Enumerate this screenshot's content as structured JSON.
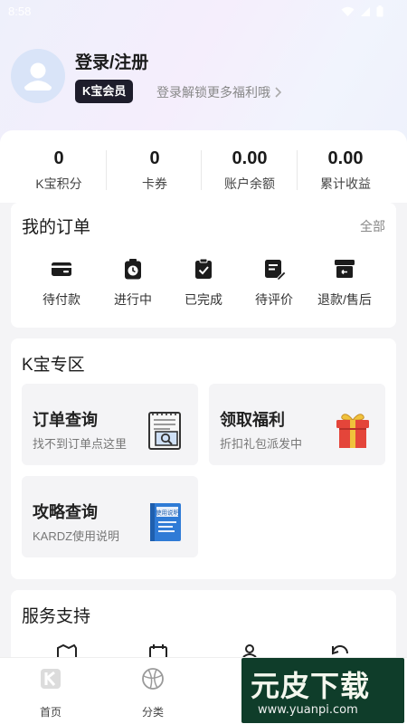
{
  "status_bar": {
    "time": "8:58"
  },
  "profile": {
    "login_title": "登录/注册",
    "vip_badge": "K宝会员",
    "vip_tip": "登录解锁更多福利哦"
  },
  "stats": [
    {
      "value": "0",
      "label": "K宝积分"
    },
    {
      "value": "0",
      "label": "卡券"
    },
    {
      "value": "0.00",
      "label": "账户余额"
    },
    {
      "value": "0.00",
      "label": "累计收益"
    }
  ],
  "orders": {
    "title": "我的订单",
    "all_label": "全部",
    "items": [
      {
        "label": "待付款",
        "icon": "wallet-icon"
      },
      {
        "label": "进行中",
        "icon": "stopwatch-icon"
      },
      {
        "label": "已完成",
        "icon": "clipboard-check-icon"
      },
      {
        "label": "待评价",
        "icon": "review-edit-icon"
      },
      {
        "label": "退款/售后",
        "icon": "refund-box-icon"
      }
    ]
  },
  "zone": {
    "title": "K宝专区",
    "tiles": [
      {
        "title": "订单查询",
        "subtitle": "找不到订单点这里",
        "icon": "order-search-icon"
      },
      {
        "title": "领取福利",
        "subtitle": "折扣礼包派发中",
        "icon": "gift-icon"
      },
      {
        "title": "攻略查询",
        "subtitle": "KARDZ使用说明",
        "icon": "manual-book-icon",
        "icon_text": "使用说明"
      }
    ]
  },
  "service": {
    "title": "服务支持"
  },
  "tabbar": {
    "items": [
      {
        "label": "首页",
        "icon": "home-k-icon"
      },
      {
        "label": "分类",
        "icon": "category-globe-icon"
      }
    ]
  },
  "watermark": {
    "title": "元皮下载",
    "url": "www.yuanpi.com"
  },
  "colors": {
    "accent_dark": "#1e1d2b",
    "gift_red": "#e4453a",
    "book_blue": "#2f7bd6"
  }
}
